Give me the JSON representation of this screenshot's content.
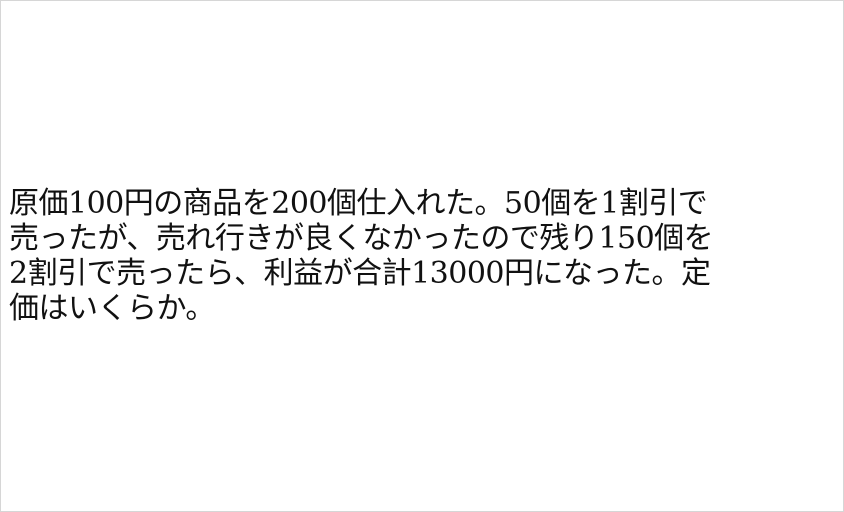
{
  "problem": {
    "lines": [
      "原価100円の商品を200個仕入れた。50個を1割引で",
      "売ったが、売れ行きが良くなかったので残り150個を",
      "2割引で売ったら、利益が合計13000円になった。定",
      "価はいくらか。"
    ]
  }
}
